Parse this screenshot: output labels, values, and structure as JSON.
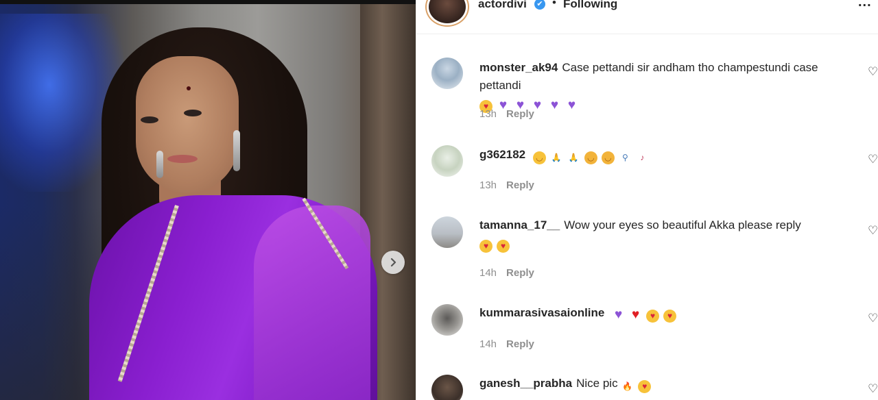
{
  "post": {
    "image_alt": "Woman in purple dress",
    "next_label": "›"
  },
  "header": {
    "username": "actordivi",
    "verified_mark": "✔",
    "separator": "•",
    "following_label": "Following",
    "more_label": "..."
  },
  "comments": [
    {
      "username": "monster_ak94",
      "text": "Case pettandi sir andham tho champestundi case pettandi",
      "emojis": [
        "love",
        "heart-purple",
        "heart-purple",
        "heart-purple",
        "heart-purple",
        "heart-purple"
      ],
      "time": "13h",
      "reply_label": "Reply"
    },
    {
      "username": "g362182",
      "text": "",
      "emojis": [
        "smile",
        "pray",
        "pray",
        "hug",
        "hug",
        "walk",
        "guitar"
      ],
      "time": "13h",
      "reply_label": "Reply"
    },
    {
      "username": "tamanna_17__",
      "text": "Wow your eyes so beautiful Akka please reply",
      "emojis": [
        "love",
        "love"
      ],
      "time": "14h",
      "reply_label": "Reply"
    },
    {
      "username": "kummarasivasaionline",
      "text": "",
      "emojis": [
        "heart-purple",
        "heart-red",
        "love",
        "love"
      ],
      "time": "14h",
      "reply_label": "Reply"
    },
    {
      "username": "ganesh__prabha",
      "text": "Nice pic",
      "emojis": [
        "fire",
        "love"
      ],
      "time": "",
      "reply_label": ""
    }
  ],
  "icons": {
    "like": "♡",
    "heart_purple": "♥",
    "heart_red": "♥",
    "love_face": "♥",
    "smile_face": "◡",
    "pray": "🙏",
    "hug": "◡",
    "walk": "⚲",
    "guitar": "♪",
    "fire": "🔥"
  },
  "colors": {
    "verified_blue": "#3897f0",
    "muted_text": "#8e8e8e",
    "dress_purple": "#8a1fd0"
  }
}
